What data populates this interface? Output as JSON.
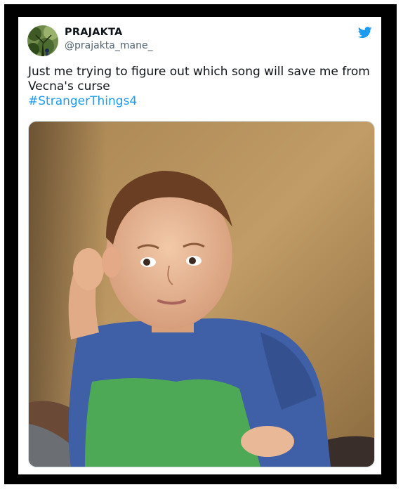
{
  "tweet": {
    "display_name": "PRAJAKTA",
    "handle": "@prajakta_mane_",
    "text": "Just me trying to figure out which song will save me from Vecna's curse",
    "hashtag": "#StrangerThings4",
    "brand_icon": "twitter-bird-icon",
    "colors": {
      "link": "#1d9bf0",
      "text": "#0f1419",
      "secondary": "#536471",
      "frame": "#000000"
    }
  },
  "media": {
    "kind": "photo"
  }
}
